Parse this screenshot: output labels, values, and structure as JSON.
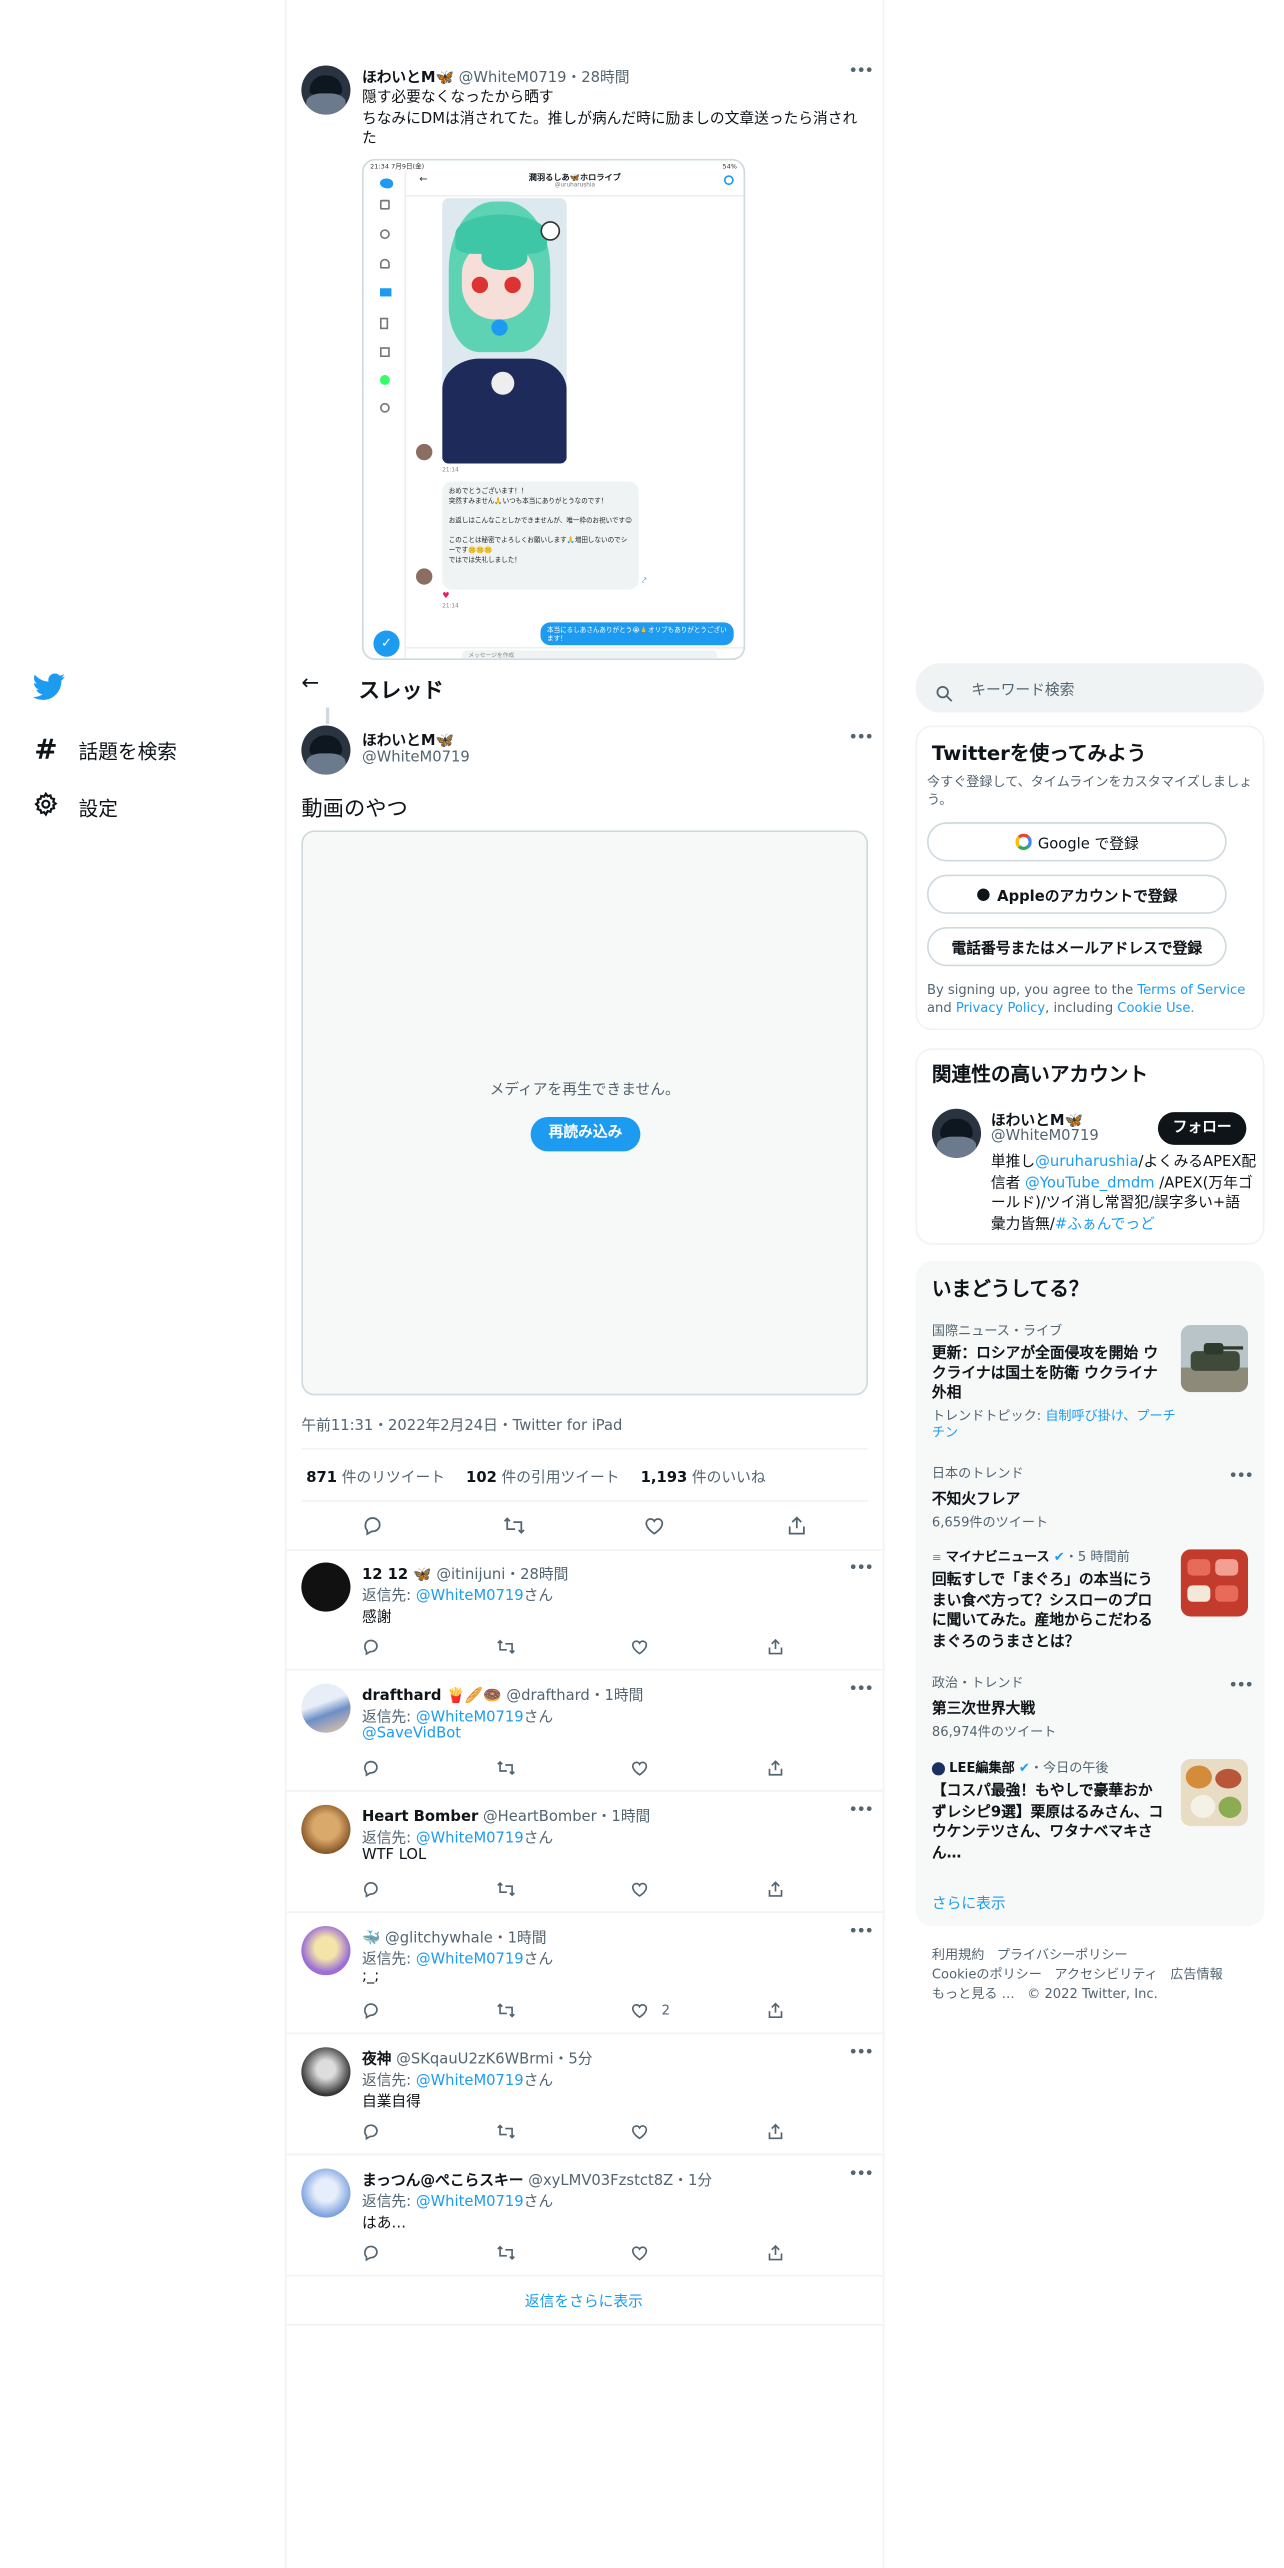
{
  "nav": {
    "explore": "話題を検索",
    "settings": "設定"
  },
  "header": {
    "title": "スレッド"
  },
  "quoted": {
    "name": "ほわいとM🦋",
    "handle": "@WhiteM0719",
    "time": "・28時間",
    "text1": "隠す必要なくなったから晒す",
    "text2": "ちなみにDMは消されてた。推しが病んだ時に励ましの文章送ったら消され",
    "text3": "た",
    "shot_status_left": "21:34 7月9日(金)",
    "shot_status_right": "54%",
    "shot_title": "潤羽るしあ🦋ホロライブ",
    "shot_sub": "@uruharushia",
    "shot_bubble": "おめでとうございます！！\n突然すみません🙏いつも本当にありがとうなのです！\n\nお返しはこんなことしかできませんが、唯一枠のお祝いです😊\n\nこのことは秘密でよろしくお願いします🙏増田しないのでシーです🤫🤫🤫\nではでは失礼しました！",
    "shot_reply": "本当にるしあさんありがとう😭🙏オリブもありがとうございます！",
    "shot_time1": "21:14",
    "shot_time2": "21:14",
    "shot_input": "メッセージを作成"
  },
  "main": {
    "name": "ほわいとM🦋",
    "handle": "@WhiteM0719",
    "text": "動画のやつ",
    "media_error": "メディアを再生できません。",
    "reload": "再読み込み",
    "timestamp": "午前11:31・2022年2月24日・Twitter for iPad",
    "retweets_n": "871",
    "retweets_l": "件のリツイート",
    "quotes_n": "102",
    "quotes_l": "件の引用ツイート",
    "likes_n": "1,193",
    "likes_l": "件のいいね"
  },
  "replying_prefix": "返信先: ",
  "replying_suffix": "さん",
  "replying_handle": "@WhiteM0719",
  "replies": [
    {
      "name": "12 12 🦋",
      "handle": "@itinijuni",
      "time": "・28時間",
      "text": "感謝",
      "likes": ""
    },
    {
      "name": "drafthard 🍟🥖🍩",
      "handle": "@drafthard",
      "time": "・1時間",
      "text": "@SaveVidBot",
      "likes": ""
    },
    {
      "name": "Heart Bomber",
      "handle": "@HeartBomber",
      "time": "・1時間",
      "text": "WTF LOL",
      "likes": ""
    },
    {
      "name": "🐳",
      "handle": "@glitchywhale",
      "time": "・1時間",
      "text": ";_;",
      "likes": "2"
    },
    {
      "name": "夜神",
      "handle": "@SKqauU2zK6WBrmi",
      "time": "・5分",
      "text": "自業自得",
      "likes": ""
    },
    {
      "name": "まっつん@ぺこらスキー",
      "handle": "@xyLMV03Fzstct8Z",
      "time": "・1分",
      "text": "はあ…",
      "likes": ""
    }
  ],
  "show_more_replies": "返信をさらに表示",
  "search": {
    "placeholder": "キーワード検索"
  },
  "signup": {
    "title": "Twitterを使ってみよう",
    "desc": "今すぐ登録して、タイムラインをカスタマイズしましょう。",
    "google": "Google で登録",
    "apple": "Appleのアカウントで登録",
    "phone": "電話番号またはメールアドレスで登録",
    "legal1": "By signing up, you agree to the ",
    "terms": "Terms of Service",
    "legal2": " and",
    "privacy": "Privacy Policy",
    "legal3": ", including ",
    "cookie": "Cookie Use."
  },
  "relevant": {
    "title": "関連性の高いアカウント",
    "name": "ほわいとM🦋",
    "handle": "@WhiteM0719",
    "follow": "フォロー",
    "bio1a": "単推し",
    "bio1b": "@uruharushia",
    "bio1c": "/よくみるAPEX配",
    "bio2a": "信者 ",
    "bio2b": "@YouTube_dmdm",
    "bio2c": " /APEX(万年ゴ",
    "bio3": "ールド)/ツイ消し常習犯/誤字多い+語",
    "bio4a": "彙力皆無/",
    "bio4b": "#ふぁんでっど"
  },
  "trends": {
    "title": "いまどうしてる？",
    "items": [
      {
        "meta": "国際ニュース・ライブ",
        "title1": "更新：ロシアが全面侵攻を開始 ウ",
        "title2": "クライナは国土を防衛 ウクライナ",
        "title3": "外相",
        "topic_label": "トレンドトピック: ",
        "topic1": "自制呼び掛け、プーチ",
        "topic2": "チン"
      },
      {
        "meta": "日本のトレンド",
        "title": "不知火フレア",
        "count": "6,659件のツイート"
      },
      {
        "source": "マイナビニュース",
        "time": "・5 時間前",
        "title1": "回転すしで「まぐろ」の本当にう",
        "title2": "まい食べ方って？シスローのプロ",
        "title3": "に聞いてみた。産地からこだわる",
        "title4": "まぐろのうまさとは？"
      },
      {
        "meta": "政治・トレンド",
        "title": "第三次世界大戦",
        "count": "86,974件のツイート"
      },
      {
        "source": "LEE編集部",
        "time": "・今日の午後",
        "title1": "【コスパ最強！もやしで豪華おか",
        "title2": "ずレシピ9選】栗原はるみさん、コ",
        "title3": "ウケンテツさん、ワタナベマキさ",
        "title4": "ん…"
      }
    ],
    "show_more": "さらに表示"
  },
  "footer": {
    "line1": [
      "利用規約",
      "プライバシーポリシー"
    ],
    "line2": [
      "Cookieのポリシー",
      "アクセシビリティ",
      "広告情報"
    ],
    "line3_more": "もっと見る …",
    "copyright": "© 2022 Twitter, Inc."
  },
  "colors": {
    "accent": "#1d9bf0",
    "text": "#0f1419",
    "secondary": "#536471",
    "border": "#eff3f4",
    "panel": "#f7f9f9"
  }
}
